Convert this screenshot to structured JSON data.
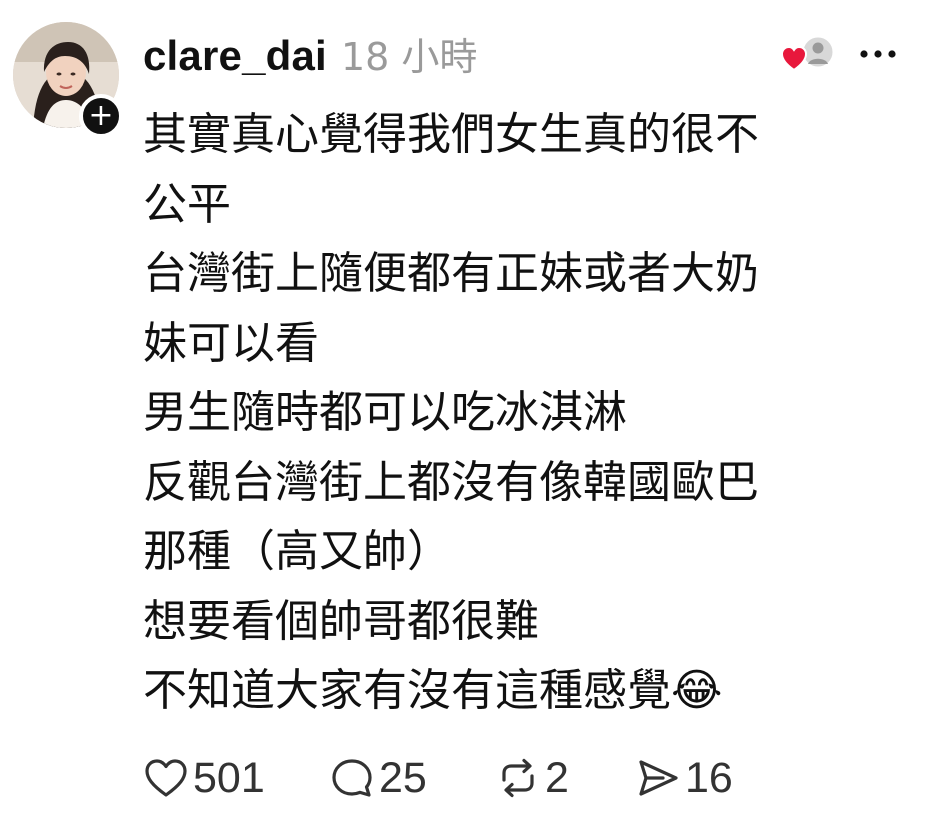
{
  "post": {
    "username": "clare_dai",
    "timestamp": "18 小時",
    "text_lines": [
      "其實真心覺得我們女生真的很不",
      "公平",
      "台灣街上隨便都有正妹或者大奶",
      "妹可以看",
      "男生隨時都可以吃冰淇淋",
      "反觀台灣街上都沒有像韓國歐巴",
      "那種（高又帥）",
      "想要看個帥哥都很難",
      "不知道大家有沒有這種感覺😂"
    ]
  },
  "actions": {
    "likes": "501",
    "replies": "25",
    "reposts": "2",
    "shares": "16"
  },
  "icons": {
    "avatar": "profile-photo",
    "follow": "plus-icon",
    "liked_by": "heart-with-avatar-icon",
    "more": "more-dots-icon",
    "like": "heart-icon",
    "reply": "speech-bubble-icon",
    "repost": "repost-icon",
    "share": "send-icon"
  },
  "colors": {
    "text": "#111111",
    "muted": "#9a9a9a",
    "heart_red": "#e8183c"
  }
}
